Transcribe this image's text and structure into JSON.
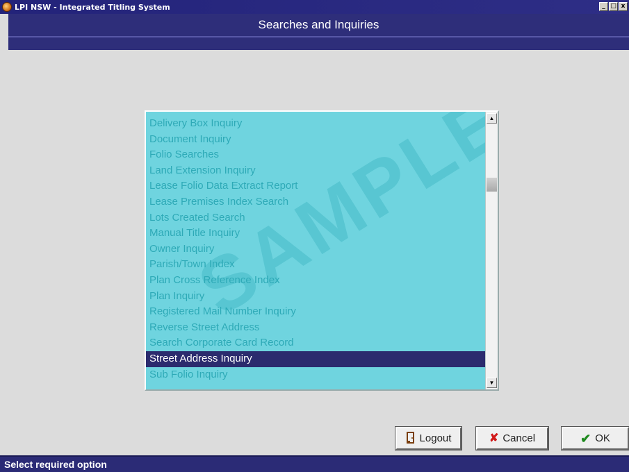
{
  "window": {
    "title": "LPI NSW - Integrated Titling System",
    "minimize_glyph": "_",
    "maximize_glyph": "□",
    "close_glyph": "x"
  },
  "header": {
    "title": "Searches and Inquiries"
  },
  "list": {
    "items": [
      "Delivery Box Inquiry",
      "Document Inquiry",
      "Folio Searches",
      "Land Extension Inquiry",
      "Lease Folio Data Extract Report",
      "Lease Premises Index Search",
      "Lots Created Search",
      "Manual Title Inquiry",
      "Owner Inquiry",
      "Parish/Town Index",
      "Plan Cross Reference Index",
      "Plan Inquiry",
      "Registered Mail Number Inquiry",
      "Reverse Street Address",
      "Search Corporate Card Record",
      "Street Address Inquiry",
      "Sub Folio Inquiry"
    ],
    "selected": "Street Address Inquiry",
    "watermark": "SAMPLE",
    "scroll_up_glyph": "▲",
    "scroll_down_glyph": "▼"
  },
  "buttons": {
    "logout_label": "Logout",
    "cancel_label": "Cancel",
    "ok_label": "OK",
    "logout_icon": "door-exit-icon",
    "cancel_icon": "x-icon",
    "ok_icon": "checkmark-icon",
    "cancel_glyph": "✘",
    "ok_glyph": "✔"
  },
  "status": {
    "text": "Select required option"
  },
  "colors": {
    "titlebar": "#23237a",
    "header": "#2e2e7a",
    "list_bg": "#6fd4df",
    "list_text": "#2eaab7",
    "selected_bg": "#2b2b6e",
    "statusbar": "#2b2b76"
  }
}
